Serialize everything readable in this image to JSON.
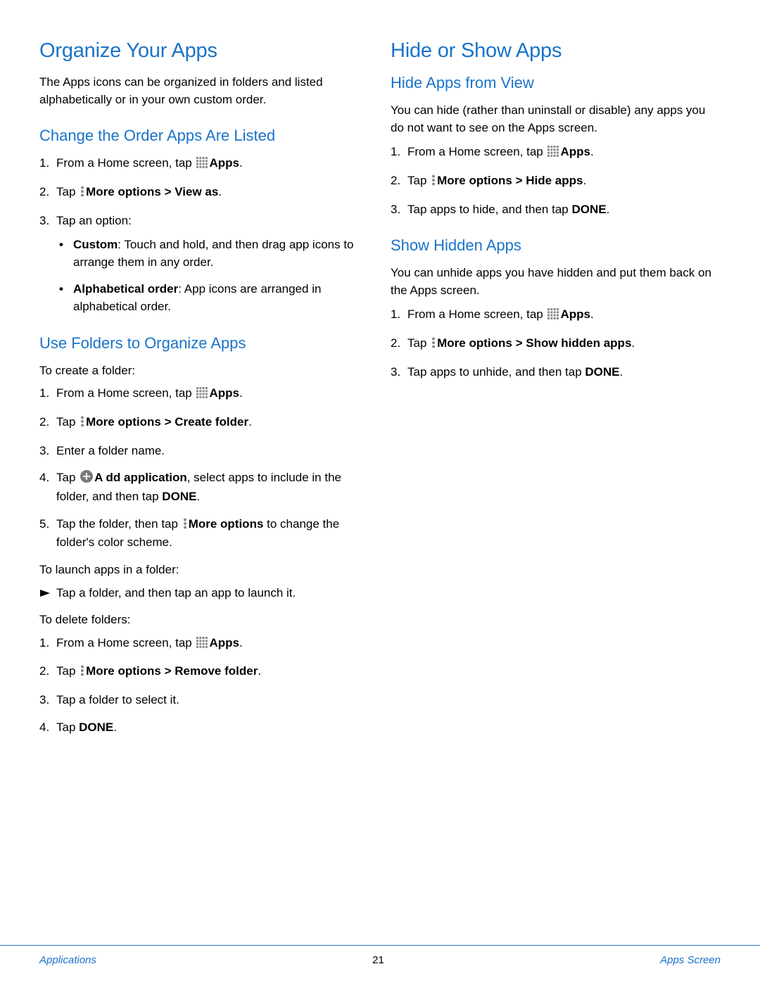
{
  "left": {
    "h1": "Organize Your Apps",
    "intro": "The Apps icons can be organized in folders and listed alphabetically or in your own custom order.",
    "sec1": {
      "title": "Change the Order Apps Are Listed",
      "step1_pre": "From a Home screen, tap ",
      "step1_bold": "Apps",
      "step1_post": ".",
      "step2_pre": "Tap ",
      "step2_bold": "More options > View as",
      "step2_post": ".",
      "step3": "Tap an option:",
      "bullet1_bold": "Custom",
      "bullet1_rest": ": Touch and hold, and then drag app icons to arrange them in any order.",
      "bullet2_bold": "Alphabetical order",
      "bullet2_rest": ": App icons are arranged in alphabetical order."
    },
    "sec2": {
      "title": "Use Folders to Organize Apps",
      "create_intro": "To create a folder:",
      "c1_pre": "From a Home screen, tap ",
      "c1_bold": "Apps",
      "c1_post": ".",
      "c2_pre": "Tap ",
      "c2_bold": "More options > Create folder",
      "c2_post": ".",
      "c3": "Enter a folder name.",
      "c4_pre": "Tap ",
      "c4_bold": "A dd application",
      "c4_rest": ", select apps to include in the folder, and then tap ",
      "c4_done": "DONE",
      "c4_post": ".",
      "c5_pre": "Tap the folder, then tap ",
      "c5_bold": "More options",
      "c5_rest": " to change the folder's color scheme.",
      "launch_intro": "To launch apps in a folder:",
      "launch_text": "Tap a folder, and then tap an app to launch it.",
      "delete_intro": "To delete folders:",
      "d1_pre": "From a Home screen, tap ",
      "d1_bold": "Apps",
      "d1_post": ".",
      "d2_pre": "Tap ",
      "d2_bold": "More options > Remove folder",
      "d2_post": ".",
      "d3": "Tap a folder to select it.",
      "d4_pre": "Tap ",
      "d4_bold": "DONE",
      "d4_post": "."
    }
  },
  "right": {
    "h1": "Hide or Show Apps",
    "sec1": {
      "title": "Hide Apps from View",
      "intro": "You can hide (rather than uninstall or disable) any apps you do not want to see on the Apps screen.",
      "s1_pre": "From a Home screen, tap ",
      "s1_bold": "Apps",
      "s1_post": ".",
      "s2_pre": "Tap ",
      "s2_bold": "More options > Hide apps",
      "s2_post": ".",
      "s3_pre": "Tap apps to hide, and then tap ",
      "s3_bold": "DONE",
      "s3_post": "."
    },
    "sec2": {
      "title": "Show Hidden Apps",
      "intro": "You can unhide apps you have hidden and put them back on the Apps screen.",
      "s1_pre": "From a Home screen, tap ",
      "s1_bold": "Apps",
      "s1_post": ".",
      "s2_pre": "Tap ",
      "s2_bold": "More options > Show hidden apps",
      "s2_post": ".",
      "s3_pre": "Tap apps to unhide, and then tap ",
      "s3_bold": "DONE",
      "s3_post": "."
    }
  },
  "footer": {
    "left": "Applications",
    "page": "21",
    "right": "Apps Screen"
  }
}
